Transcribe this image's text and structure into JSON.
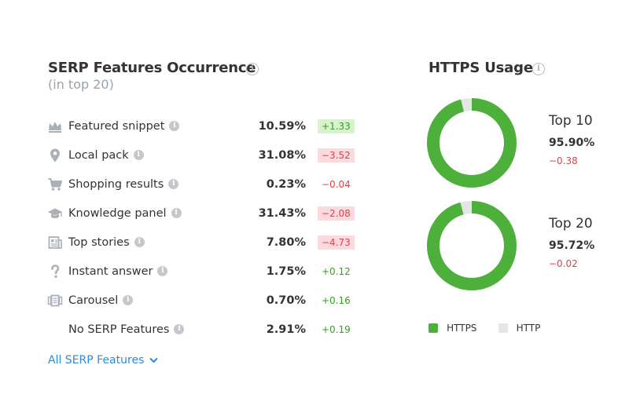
{
  "serp": {
    "title": "SERP Features Occurrence",
    "subtitle": "(in top 20)",
    "info_glyph": "i",
    "rows": [
      {
        "icon": "crown-icon",
        "label": "Featured snippet",
        "pct": "10.59%",
        "change": "+1.33",
        "style": "pos-badge"
      },
      {
        "icon": "location-pin-icon",
        "label": "Local pack",
        "pct": "31.08%",
        "change": "−3.52",
        "style": "neg-badge"
      },
      {
        "icon": "shopping-cart-icon",
        "label": "Shopping results",
        "pct": "0.23%",
        "change": "−0.04",
        "style": "neg"
      },
      {
        "icon": "graduation-cap-icon",
        "label": "Knowledge panel",
        "pct": "31.43%",
        "change": "−2.08",
        "style": "neg-badge"
      },
      {
        "icon": "newspaper-icon",
        "label": "Top stories",
        "pct": "7.80%",
        "change": "−4.73",
        "style": "neg-badge"
      },
      {
        "icon": "question-mark-icon",
        "label": "Instant answer",
        "pct": "1.75%",
        "change": "+0.12",
        "style": "pos"
      },
      {
        "icon": "carousel-icon",
        "label": "Carousel",
        "pct": "0.70%",
        "change": "+0.16",
        "style": "pos"
      },
      {
        "icon": "",
        "label": "No SERP Features",
        "pct": "2.91%",
        "change": "+0.19",
        "style": "pos"
      }
    ],
    "all_link": "All SERP Features"
  },
  "https": {
    "title": "HTTPS Usage",
    "colors": {
      "https": "#4cb03a",
      "http": "#e3e5e7"
    },
    "donuts": [
      {
        "label": "Top 10",
        "value": "95.90%",
        "change": "−0.38",
        "fraction": 0.959
      },
      {
        "label": "Top 20",
        "value": "95.72%",
        "change": "−0.02",
        "fraction": 0.9572
      }
    ],
    "legend": {
      "https": "HTTPS",
      "http": "HTTP"
    }
  }
}
